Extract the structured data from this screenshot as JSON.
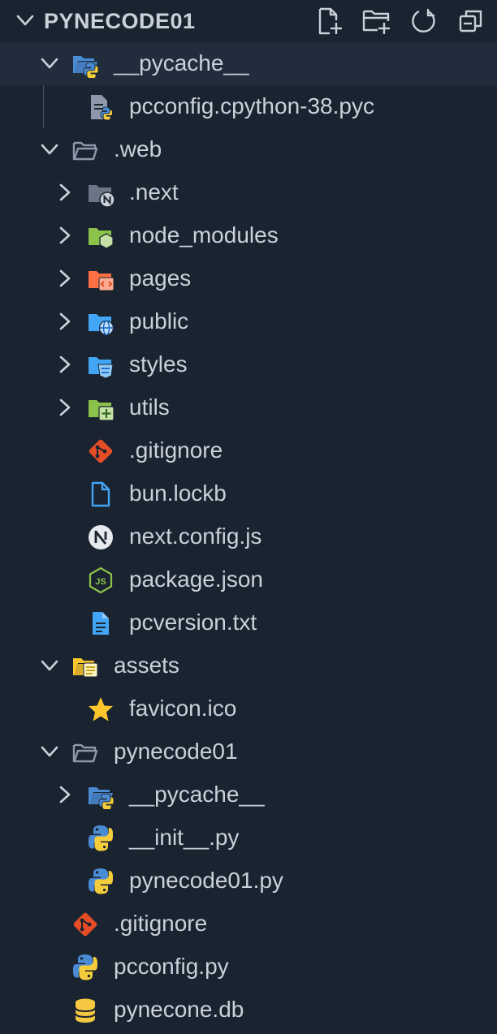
{
  "explorer": {
    "title": "PYNECODE01",
    "actions": [
      {
        "icon": "new-file-icon"
      },
      {
        "icon": "new-folder-icon"
      },
      {
        "icon": "refresh-icon"
      },
      {
        "icon": "collapse-all-icon"
      }
    ]
  },
  "tree": [
    {
      "label": "__pycache__",
      "depth": 1,
      "kind": "folder",
      "expanded": true,
      "icon": "python-folder-icon",
      "selected": true
    },
    {
      "label": "pcconfig.cpython-38.pyc",
      "depth": 2,
      "kind": "file",
      "icon": "pyc-file-icon"
    },
    {
      "label": ".web",
      "depth": 1,
      "kind": "folder",
      "expanded": true,
      "icon": "folder-open-icon"
    },
    {
      "label": ".next",
      "depth": 2,
      "kind": "folder",
      "expanded": false,
      "icon": "next-folder-icon"
    },
    {
      "label": "node_modules",
      "depth": 2,
      "kind": "folder",
      "expanded": false,
      "icon": "node-folder-icon"
    },
    {
      "label": "pages",
      "depth": 2,
      "kind": "folder",
      "expanded": false,
      "icon": "pages-folder-icon"
    },
    {
      "label": "public",
      "depth": 2,
      "kind": "folder",
      "expanded": false,
      "icon": "public-folder-icon"
    },
    {
      "label": "styles",
      "depth": 2,
      "kind": "folder",
      "expanded": false,
      "icon": "styles-folder-icon"
    },
    {
      "label": "utils",
      "depth": 2,
      "kind": "folder",
      "expanded": false,
      "icon": "utils-folder-icon"
    },
    {
      "label": ".gitignore",
      "depth": 2,
      "kind": "file",
      "icon": "git-icon"
    },
    {
      "label": "bun.lockb",
      "depth": 2,
      "kind": "file",
      "icon": "file-icon"
    },
    {
      "label": "next.config.js",
      "depth": 2,
      "kind": "file",
      "icon": "nextjs-icon"
    },
    {
      "label": "package.json",
      "depth": 2,
      "kind": "file",
      "icon": "nodejs-icon"
    },
    {
      "label": "pcversion.txt",
      "depth": 2,
      "kind": "file",
      "icon": "text-file-icon"
    },
    {
      "label": "assets",
      "depth": 1,
      "kind": "folder",
      "expanded": true,
      "icon": "assets-folder-icon"
    },
    {
      "label": "favicon.ico",
      "depth": 2,
      "kind": "file",
      "icon": "star-icon"
    },
    {
      "label": "pynecode01",
      "depth": 1,
      "kind": "folder",
      "expanded": true,
      "icon": "folder-open-icon"
    },
    {
      "label": "__pycache__",
      "depth": 2,
      "kind": "folder",
      "expanded": false,
      "icon": "python-folder-icon"
    },
    {
      "label": "__init__.py",
      "depth": 2,
      "kind": "file",
      "icon": "python-icon"
    },
    {
      "label": "pynecode01.py",
      "depth": 2,
      "kind": "file",
      "icon": "python-icon"
    },
    {
      "label": ".gitignore",
      "depth": 1,
      "kind": "file",
      "icon": "git-icon"
    },
    {
      "label": "pcconfig.py",
      "depth": 1,
      "kind": "file",
      "icon": "python-icon"
    },
    {
      "label": "pynecone.db",
      "depth": 1,
      "kind": "file",
      "icon": "database-icon"
    }
  ],
  "colors": {
    "background": "#1a2330",
    "selected_row": "#212d3d",
    "text": "#c9d1d9",
    "chevron": "#c9d1d9",
    "git": "#e44d26",
    "python_blue": "#4a8bd4",
    "python_yellow": "#f5cd3c",
    "folder_grey": "#8d99aa",
    "node_green": "#8bc34a",
    "pages_orange": "#ff7043",
    "public_blue": "#42a5f5",
    "styles_blue": "#42a5f5",
    "file_blue": "#42a5f5",
    "star_yellow": "#fcc62c",
    "db_yellow": "#f5c842",
    "assets_yellow": "#fcc62c"
  }
}
